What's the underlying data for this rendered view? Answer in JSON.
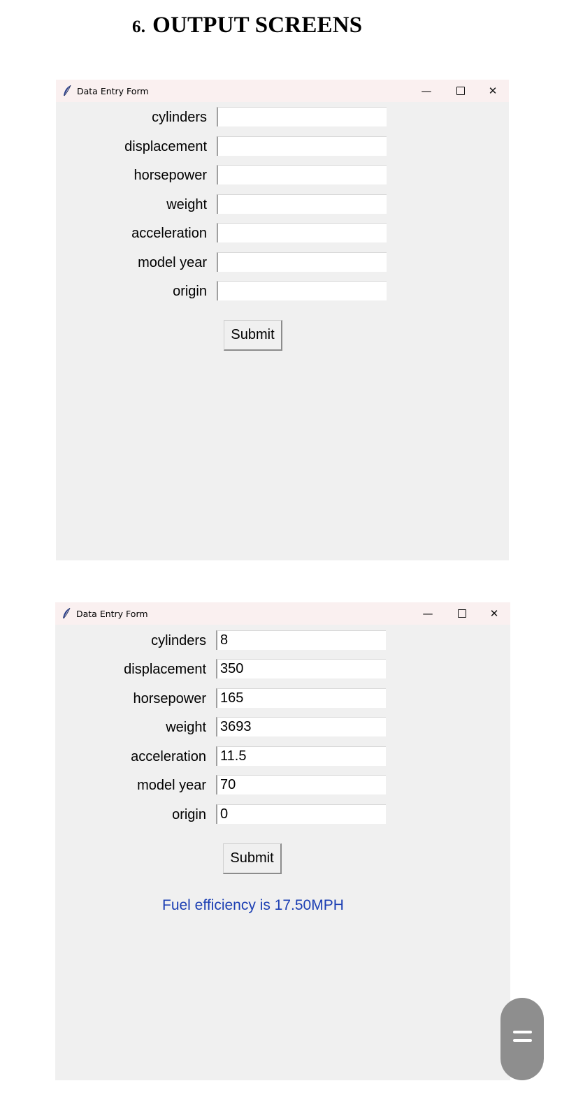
{
  "heading": {
    "number": "6.",
    "text": "OUTPUT SCREENS"
  },
  "window_empty": {
    "title": "Data Entry Form",
    "controls": {
      "minimize": "—",
      "close": "✕"
    },
    "fields": [
      {
        "label": "cylinders",
        "value": ""
      },
      {
        "label": "displacement",
        "value": ""
      },
      {
        "label": "horsepower",
        "value": ""
      },
      {
        "label": "weight",
        "value": ""
      },
      {
        "label": "acceleration",
        "value": ""
      },
      {
        "label": "model year",
        "value": ""
      },
      {
        "label": "origin",
        "value": ""
      }
    ],
    "submit_label": "Submit"
  },
  "window_filled": {
    "title": "Data Entry Form",
    "controls": {
      "minimize": "—",
      "close": "✕"
    },
    "fields": [
      {
        "label": "cylinders",
        "value": "8"
      },
      {
        "label": "displacement",
        "value": "350"
      },
      {
        "label": "horsepower",
        "value": "165"
      },
      {
        "label": "weight",
        "value": "3693"
      },
      {
        "label": "acceleration",
        "value": "11.5"
      },
      {
        "label": "model year",
        "value": "70"
      },
      {
        "label": "origin",
        "value": "0"
      }
    ],
    "submit_label": "Submit",
    "result": "Fuel efficiency is 17.50MPH"
  },
  "colors": {
    "result_text": "#1c3fb3",
    "window_bg": "#f0f0f0",
    "titlebar_bg": "#faf0f0"
  },
  "icons": {
    "window_icon": "feather-icon",
    "scroll": "scroll-handle-icon"
  }
}
